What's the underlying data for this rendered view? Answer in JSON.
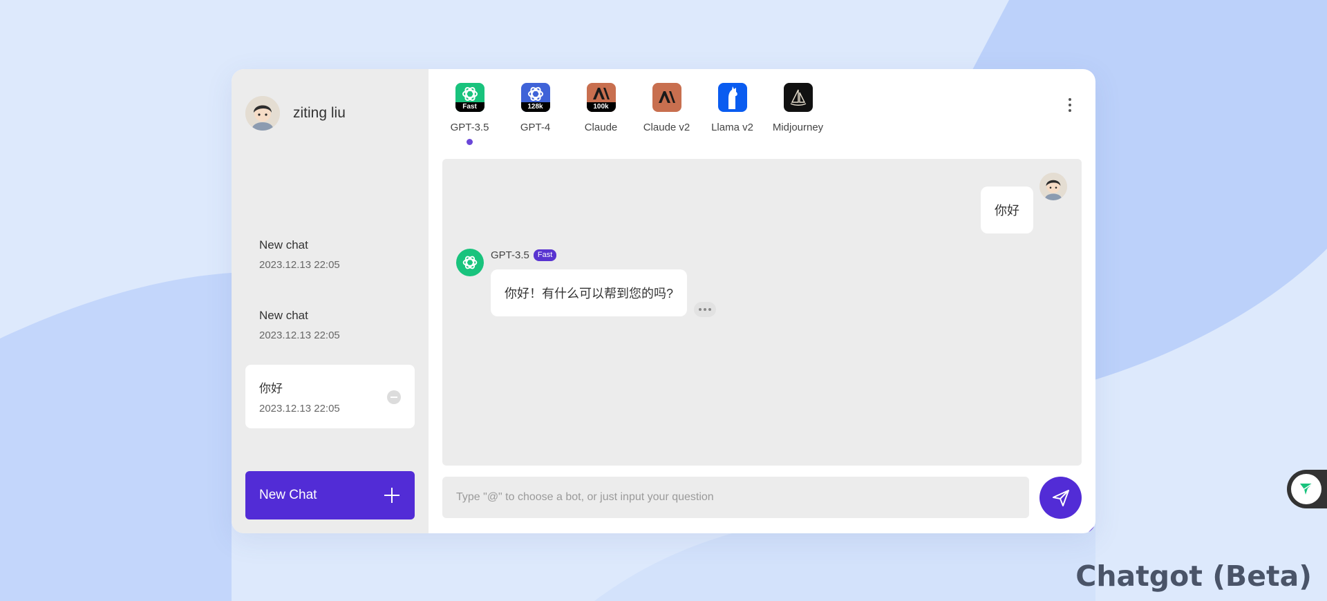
{
  "user": {
    "name": "ziting liu"
  },
  "sessions": [
    {
      "title": "New chat",
      "date": "2023.12.13 22:05"
    },
    {
      "title": "New chat",
      "date": "2023.12.13 22:05"
    },
    {
      "title": "你好",
      "date": "2023.12.13 22:05",
      "active": true
    }
  ],
  "sidebar": {
    "new_chat_label": "New Chat"
  },
  "bots": [
    {
      "label": "GPT-3.5",
      "badge": "Fast",
      "color": "#19c37d",
      "selected": true
    },
    {
      "label": "GPT-4",
      "badge": "128k",
      "color": "#3f63d8"
    },
    {
      "label": "Claude",
      "badge": "100k",
      "color": "#c86f4f"
    },
    {
      "label": "Claude v2",
      "badge": "",
      "color": "#c86f4f"
    },
    {
      "label": "Llama v2",
      "badge": "",
      "color": "#0a5cf0"
    },
    {
      "label": "Midjourney",
      "badge": "",
      "color": "#111111"
    }
  ],
  "messages": {
    "user_text": "你好",
    "bot_name": "GPT-3.5",
    "bot_badge": "Fast",
    "bot_text": "你好！有什么可以帮到您的吗?"
  },
  "composer": {
    "placeholder": "Type \"@\" to choose a bot, or just input your question",
    "value": ""
  },
  "brand": {
    "text": "Chatgot (Beta)"
  },
  "colors": {
    "accent": "#522cd6",
    "sidebar_bg": "#ececec",
    "chat_bg": "#ececec",
    "page_bg": "#dde9fc"
  }
}
